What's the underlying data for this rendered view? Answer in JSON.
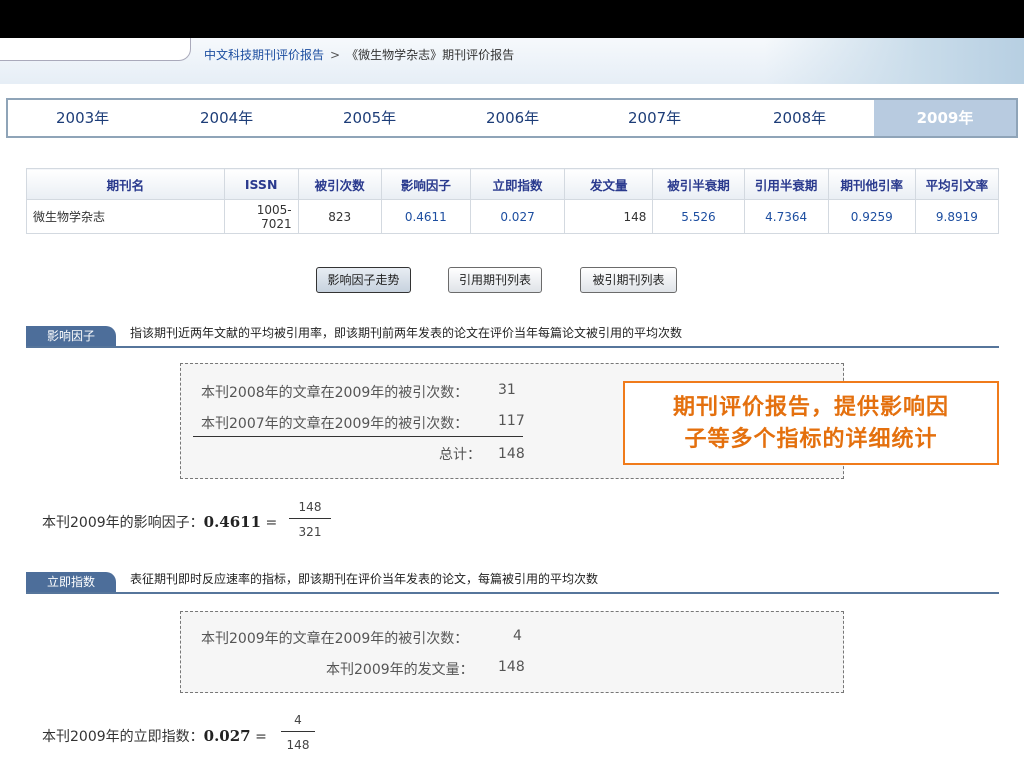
{
  "breadcrumb": {
    "root": "中文科技期刊评价报告",
    "separator": ">",
    "current": "《微生物学杂志》期刊评价报告"
  },
  "years": [
    "2003年",
    "2004年",
    "2005年",
    "2006年",
    "2007年",
    "2008年",
    "2009年"
  ],
  "active_year": "2009年",
  "table": {
    "headers": [
      "期刊名",
      "ISSN",
      "被引次数",
      "影响因子",
      "立即指数",
      "发文量",
      "被引半衰期",
      "引用半衰期",
      "期刊他引率",
      "平均引文率"
    ],
    "row": [
      "微生物学杂志",
      "1005-7021",
      "823",
      "0.4611",
      "0.027",
      "148",
      "5.526",
      "4.7364",
      "0.9259",
      "9.8919"
    ]
  },
  "buttons": {
    "trend": "影响因子走势",
    "citing": "引用期刊列表",
    "cited": "被引期刊列表"
  },
  "impact": {
    "tag": "影响因子",
    "description": "指该期刊近两年文献的平均被引用率，即该期刊前两年发表的论文在评价当年每篇论文被引用的平均次数",
    "rows": [
      {
        "label": "本刊2008年的文章在2009年的被引次数：",
        "value": "31"
      },
      {
        "label": "本刊2007年的文章在2009年的被引次数：",
        "value": "117"
      },
      {
        "label": "总计：",
        "value": "148"
      }
    ],
    "formula_prefix": "本刊2009年的影响因子：",
    "formula_value": "0.4611",
    "equals": "=",
    "numerator": "148",
    "denominator": "321"
  },
  "immediacy": {
    "tag": "立即指数",
    "description": "表征期刊即时反应速率的指标，即该期刊在评价当年发表的论文，每篇被引用的平均次数",
    "rows": [
      {
        "label": "本刊2009年的文章在2009年的被引次数：",
        "value": "4"
      },
      {
        "label": "本刊2009年的发文量：",
        "value": "148"
      }
    ],
    "formula_prefix": "本刊2009年的立即指数：",
    "formula_value": "0.027",
    "equals": "=",
    "numerator": "4",
    "denominator": "148"
  },
  "callout": {
    "line1": "期刊评价报告，提供影响因",
    "line2": "子等多个指标的详细统计"
  },
  "colors": {
    "accent_blue": "#1d4ea0",
    "section_tag": "#4d6e9a",
    "callout_orange": "#f07b1b",
    "active_tab": "#b8cbe0"
  }
}
